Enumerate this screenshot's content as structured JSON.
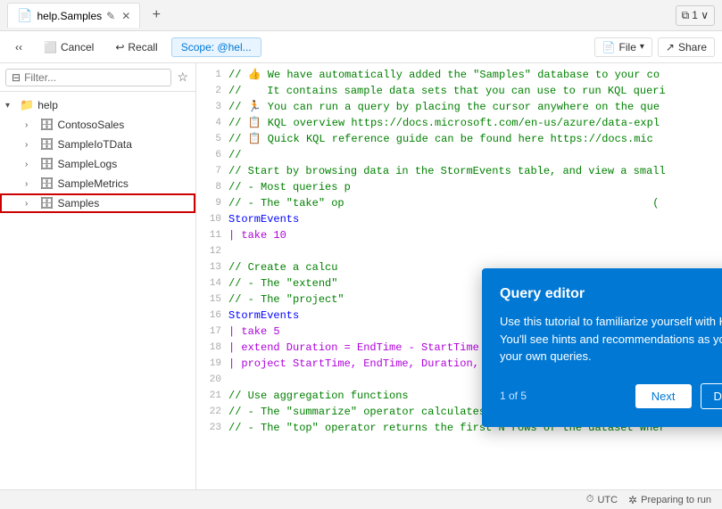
{
  "titlebar": {
    "tab_label": "help.Samples",
    "tab_icon": "📄",
    "add_tab_label": "+",
    "copy_label": "1 ∨"
  },
  "toolbar": {
    "cancel_label": "Cancel",
    "recall_label": "Recall",
    "scope_label": "Scope: @hel...",
    "file_label": "File",
    "share_label": "Share"
  },
  "sidebar": {
    "filter_placeholder": "Filter...",
    "items": [
      {
        "label": "help",
        "level": 0,
        "expanded": true,
        "icon": "📁",
        "type": "folder"
      },
      {
        "label": "ContosoSales",
        "level": 1,
        "expanded": false,
        "icon": "🗄️",
        "type": "db"
      },
      {
        "label": "SampleIoTData",
        "level": 1,
        "expanded": false,
        "icon": "🗄️",
        "type": "db"
      },
      {
        "label": "SampleLogs",
        "level": 1,
        "expanded": false,
        "icon": "🗄️",
        "type": "db"
      },
      {
        "label": "SampleMetrics",
        "level": 1,
        "expanded": false,
        "icon": "🗄️",
        "type": "db"
      },
      {
        "label": "Samples",
        "level": 1,
        "expanded": false,
        "icon": "🗄️",
        "type": "db",
        "highlighted": true
      }
    ]
  },
  "editor": {
    "lines": [
      {
        "num": 1,
        "code": "// 👍 We have automatically added the \"Samples\" database to your co",
        "type": "comment"
      },
      {
        "num": 2,
        "code": "//    It contains sample data sets that you can use to run KQL queri",
        "type": "comment"
      },
      {
        "num": 3,
        "code": "// 🏃 You can run a query by placing the cursor anywhere on the que",
        "type": "comment"
      },
      {
        "num": 4,
        "code": "// 📋 KQL overview https://docs.microsoft.com/en-us/azure/data-expl",
        "type": "comment_link"
      },
      {
        "num": 5,
        "code": "// 📋 Quick KQL reference guide can be found here https://docs.mic",
        "type": "comment_link"
      },
      {
        "num": 6,
        "code": "//",
        "type": "comment"
      },
      {
        "num": 7,
        "code": "// Start by browsing data in the StormEvents table, and view a small",
        "type": "comment"
      },
      {
        "num": 8,
        "code": "// - Most queries p                                   ",
        "type": "comment"
      },
      {
        "num": 9,
        "code": "// - The \"take\" op                                                (",
        "type": "comment"
      },
      {
        "num": 10,
        "code": "StormEvents",
        "type": "keyword"
      },
      {
        "num": 11,
        "code": "| take 10",
        "type": "pipe"
      },
      {
        "num": 12,
        "code": "",
        "type": "normal"
      },
      {
        "num": 13,
        "code": "// Create a calcu",
        "type": "comment"
      },
      {
        "num": 14,
        "code": "// - The \"extend\"",
        "type": "comment"
      },
      {
        "num": 15,
        "code": "// - The \"project\"",
        "type": "comment"
      },
      {
        "num": 16,
        "code": "StormEvents",
        "type": "keyword"
      },
      {
        "num": 17,
        "code": "| take 5",
        "type": "pipe"
      },
      {
        "num": 18,
        "code": "| extend Duration = EndTime - StartTime",
        "type": "pipe"
      },
      {
        "num": 19,
        "code": "| project StartTime, EndTime, Duration, EventType, State;",
        "type": "pipe"
      },
      {
        "num": 20,
        "code": "",
        "type": "normal"
      },
      {
        "num": 21,
        "code": "// Use aggregation functions",
        "type": "comment"
      },
      {
        "num": 22,
        "code": "// - The \"summarize\" operator calculates aggregations. You can use s",
        "type": "comment"
      },
      {
        "num": 23,
        "code": "// - The \"top\" operator returns the first N rows of the dataset wher",
        "type": "comment"
      }
    ]
  },
  "query_editor_dialog": {
    "title": "Query editor",
    "body": "Use this tutorial to familiarize yourself with KQL. You'll see hints and recommendations as you type your own queries.",
    "page_label": "1 of 5",
    "next_label": "Next",
    "dismiss_label": "Dismiss"
  },
  "statusbar": {
    "utc_label": "UTC",
    "preparing_label": "Preparing to run"
  }
}
